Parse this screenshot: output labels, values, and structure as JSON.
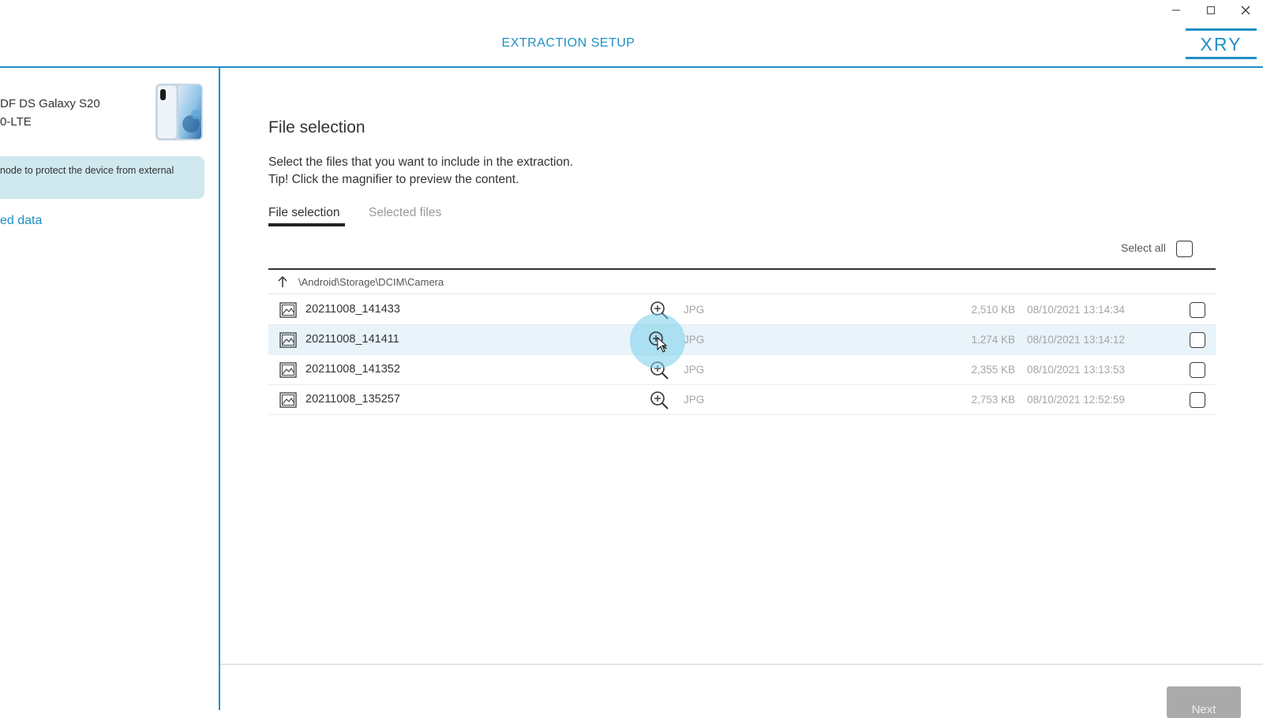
{
  "header": {
    "title": "EXTRACTION SETUP",
    "logo_text": "XRY"
  },
  "sidebar": {
    "device_line1": "DF DS Galaxy S20",
    "device_line2": "0-LTE",
    "notice_text": "node to protect the device from external",
    "link_text": "ed data"
  },
  "main": {
    "title": "File selection",
    "instruction": "Select the files that you want to include in the extraction.",
    "tip": "Tip! Click the magnifier to preview the content.",
    "tabs": [
      {
        "label": "File selection",
        "active": true
      },
      {
        "label": "Selected files",
        "active": false
      }
    ],
    "select_all_label": "Select all",
    "path": "\\Android\\Storage\\DCIM\\Camera",
    "files": [
      {
        "name": "20211008_141433",
        "type": "JPG",
        "size": "2,510 KB",
        "date": "08/10/2021 13:14:34",
        "checked": false
      },
      {
        "name": "20211008_141411",
        "type": "JPG",
        "size": "1,274 KB",
        "date": "08/10/2021 13:14:12",
        "checked": false
      },
      {
        "name": "20211008_141352",
        "type": "JPG",
        "size": "2,355 KB",
        "date": "08/10/2021 13:13:53",
        "checked": false
      },
      {
        "name": "20211008_135257",
        "type": "JPG",
        "size": "2,753 KB",
        "date": "08/10/2021 12:52:59",
        "checked": false
      }
    ]
  },
  "footer": {
    "next_label": "Next"
  },
  "icons": {
    "minimize": "minimize-icon",
    "maximize": "maximize-icon",
    "close": "close-icon",
    "up": "arrow-up-icon",
    "image": "image-icon",
    "magnifier": "zoom-in-icon"
  },
  "colors": {
    "accent": "#1f8fc5",
    "notice_bg": "#cfe9ef",
    "row_hover": "#e8f3fa"
  }
}
